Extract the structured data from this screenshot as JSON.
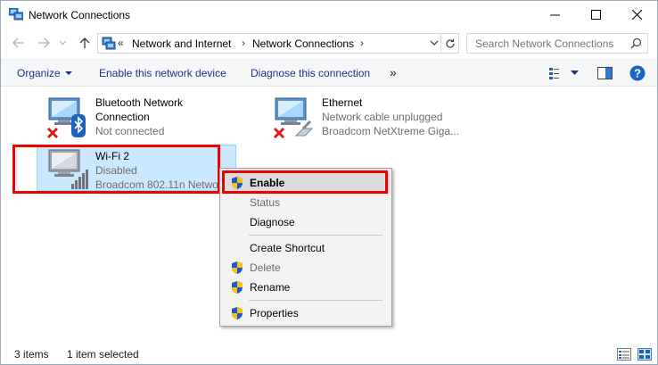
{
  "window": {
    "title": "Network Connections"
  },
  "address": {
    "overflow": "«",
    "crumbs": [
      "Network and Internet",
      "Network Connections"
    ],
    "search_placeholder": "Search Network Connections"
  },
  "toolbar": {
    "organize": "Organize",
    "enable": "Enable this network device",
    "diagnose": "Diagnose this connection",
    "more": "»"
  },
  "items": [
    {
      "name": "Bluetooth Network",
      "name2": "Connection",
      "status": "Not connected",
      "device": ""
    },
    {
      "name": "Ethernet",
      "status": "Network cable unplugged",
      "device": "Broadcom NetXtreme Giga..."
    },
    {
      "name": "Wi-Fi 2",
      "status": "Disabled",
      "device": "Broadcom 802.11n Network"
    }
  ],
  "context_menu": {
    "items": [
      {
        "label": "Enable",
        "shield": true,
        "disabled": false,
        "bold": true
      },
      {
        "label": "Status",
        "shield": false,
        "disabled": true
      },
      {
        "label": "Diagnose",
        "shield": false,
        "disabled": false
      },
      {
        "label": "Create Shortcut",
        "shield": false,
        "disabled": false
      },
      {
        "label": "Delete",
        "shield": true,
        "disabled": true
      },
      {
        "label": "Rename",
        "shield": true,
        "disabled": false
      },
      {
        "label": "Properties",
        "shield": true,
        "disabled": false
      }
    ]
  },
  "statusbar": {
    "count": "3 items",
    "selected": "1 item selected"
  },
  "colors": {
    "accent": "#1e3287",
    "highlight_red": "#e00000",
    "selection": "#cce8ff"
  },
  "icons": {
    "app": "network-connections-icon",
    "back": "back-arrow-icon",
    "forward": "forward-arrow-icon",
    "recent": "chevron-down-icon",
    "up": "up-arrow-icon",
    "refresh": "refresh-icon",
    "search": "search-icon",
    "view": "change-view-icon",
    "preview": "preview-pane-icon",
    "help": "help-icon",
    "shield": "uac-shield-icon"
  }
}
